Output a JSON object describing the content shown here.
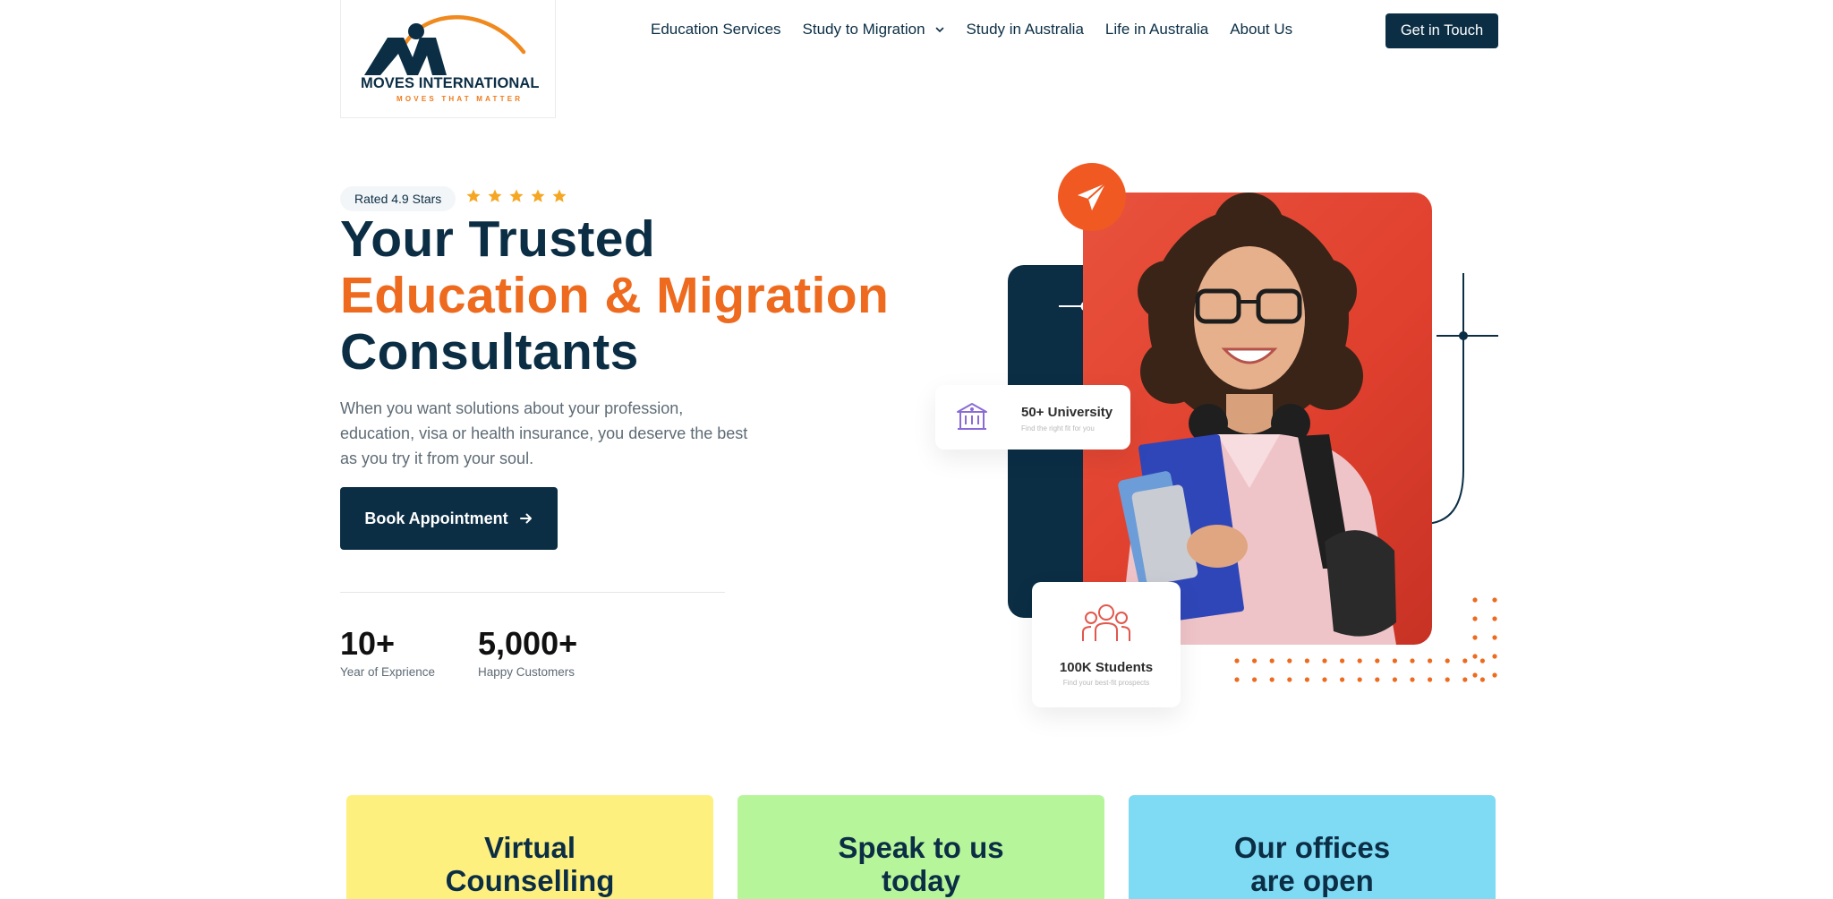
{
  "brand": {
    "name": "MOVES INTERNATIONAL",
    "tagline": "MOVES THAT MATTER",
    "colors": {
      "navy": "#0b2e45",
      "orange": "#ee6a1e",
      "red": "#e0402e"
    }
  },
  "nav": {
    "items": [
      {
        "label": "Education Services"
      },
      {
        "label": "Study to Migration",
        "has_dropdown": true
      },
      {
        "label": "Study in Australia"
      },
      {
        "label": "Life in Australia"
      },
      {
        "label": "About Us"
      }
    ],
    "cta_label": "Get in Touch"
  },
  "hero": {
    "rating_label": "Rated 4.9 Stars",
    "rating_stars": 5,
    "title_line1": "Your Trusted",
    "title_line2": "Education & Migration",
    "title_line3": "Consultants",
    "description": "When you want solutions about your profession, education, visa or health insurance, you deserve the best as you try it from your soul.",
    "button_label": "Book Appointment",
    "stats": [
      {
        "value": "10+",
        "label": "Year of Exprience"
      },
      {
        "value": "5,000+",
        "label": "Happy Customers"
      }
    ],
    "cards": {
      "university": {
        "title": "50+ University",
        "subtitle": "Find the right fit for you"
      },
      "students": {
        "title": "100K Students",
        "subtitle": "Find your best-fit prospects"
      }
    }
  },
  "info_cards": [
    {
      "title": "Virtual Counselling",
      "color": "#fdf07f"
    },
    {
      "title": "Speak to us today",
      "color": "#b6f59a"
    },
    {
      "title": "Our offices are open",
      "color": "#7fdaf4"
    }
  ]
}
